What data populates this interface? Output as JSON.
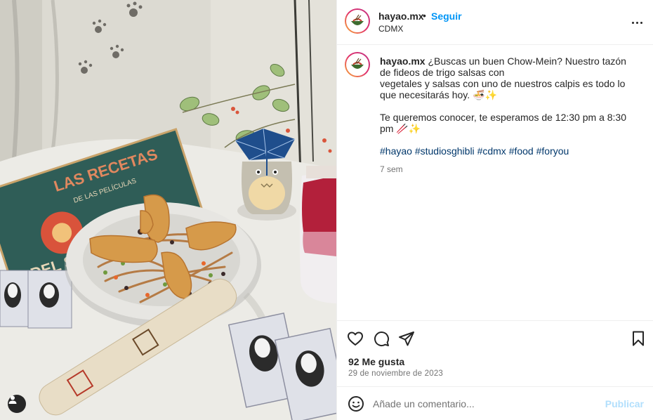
{
  "post": {
    "username": "hayao.mx",
    "follow_label": "Seguir",
    "separator": "•",
    "location": "CDMX",
    "more_icon": "more-horizontal-icon"
  },
  "caption": {
    "username": "hayao.mx",
    "line1": " ¿Buscas un buen Chow-Mein? Nuestro tazón de fideos de trigo salsas con",
    "line2": "vegetales y salsas con uno de nuestros calpis es todo lo que necesitarás hoy. 🍜✨",
    "line3": "Te queremos conocer, te esperamos de 12:30 pm a 8:30 pm 🥢✨",
    "hashtags": [
      "#hayao",
      "#studiosghibli",
      "#cdmx",
      "#food",
      "#foryou"
    ],
    "time_ago": "7 sem"
  },
  "actions": {
    "icons": [
      "heart-icon",
      "comment-icon",
      "share-icon",
      "bookmark-icon"
    ],
    "likes": "92 Me gusta",
    "date": "29 de noviembre de 2023"
  },
  "comment": {
    "placeholder": "Añade un comentario...",
    "publish_label": "Publicar",
    "emoji_icon": "emoji-icon"
  },
  "colors": {
    "link_blue": "#0095f6",
    "hashtag_blue": "#00376b",
    "muted": "#737373",
    "publish_disabled": "#b2dffc"
  }
}
